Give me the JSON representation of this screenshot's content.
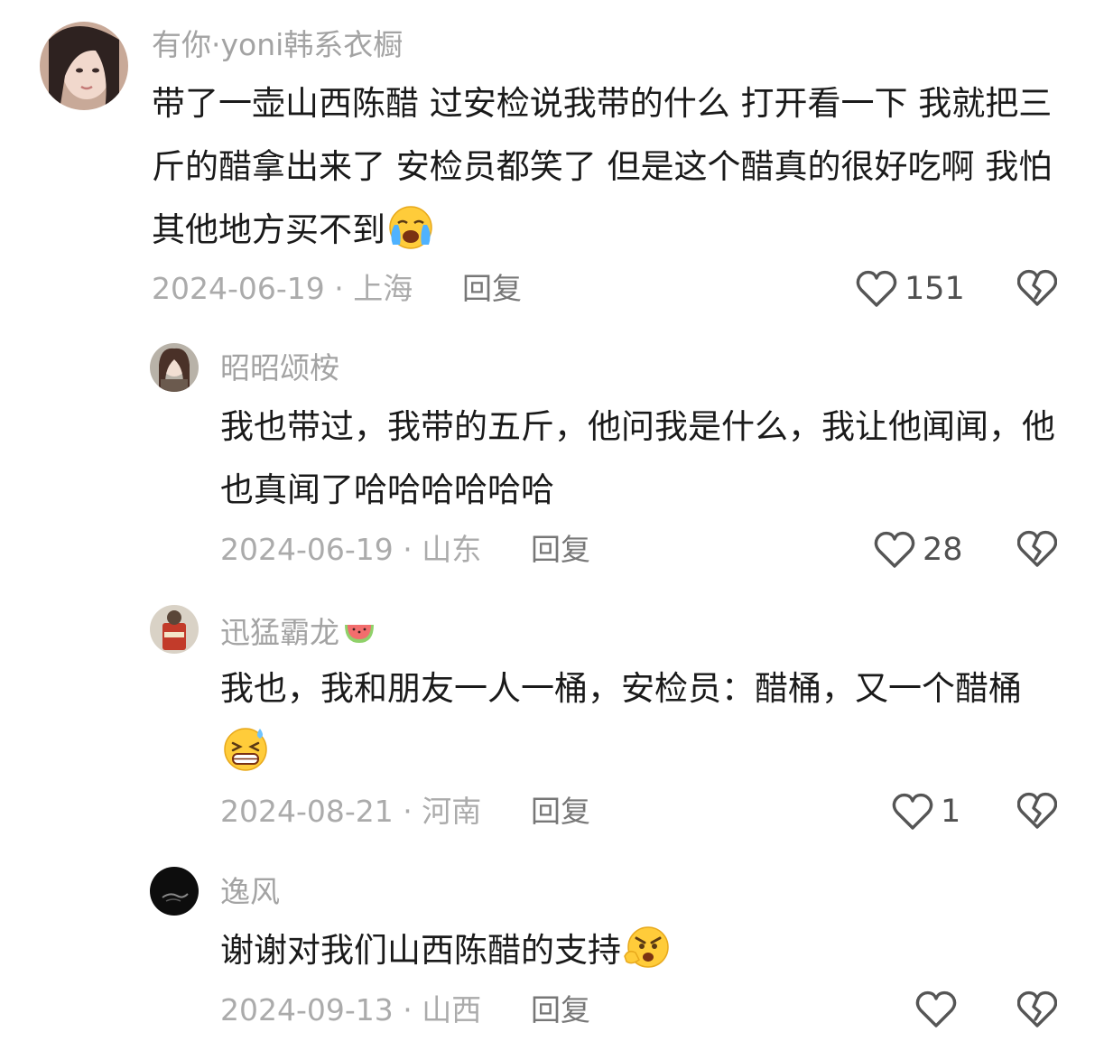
{
  "comments": [
    {
      "username": "有你·yoni韩系衣橱",
      "text": "带了一壶山西陈醋 过安检说我带的什么 打开看一下 我就把三斤的醋拿出来了 安检员都笑了 但是这个醋真的很好吃啊 我怕其他地方买不到",
      "emoji": "crying-face-emoji",
      "date": "2024-06-19",
      "location": "上海",
      "reply_label": "回复",
      "likes": "151"
    },
    {
      "username": "昭昭颂桉",
      "text": "我也带过，我带的五斤，他问我是什么，我让他闻闻，他也真闻了哈哈哈哈哈哈",
      "date": "2024-06-19",
      "location": "山东",
      "reply_label": "回复",
      "likes": "28"
    },
    {
      "username": "迅猛霸龙",
      "username_emoji": "watermelon-emoji",
      "text": "我也，我和朋友一人一桶，安检员：醋桶，又一个醋桶",
      "emoji": "grinning-sweat-emoji",
      "date": "2024-08-21",
      "location": "河南",
      "reply_label": "回复",
      "likes": "1"
    },
    {
      "username": "逸风",
      "text": "谢谢对我们山西陈醋的支持",
      "emoji": "angry-pointing-emoji",
      "date": "2024-09-13",
      "location": "山西",
      "reply_label": "回复",
      "likes": ""
    }
  ],
  "separator": " · ",
  "icons": {
    "like": "heart-outline-icon",
    "dislike": "broken-heart-icon"
  },
  "colors": {
    "username": "#a3a3a3",
    "text": "#1a1a1a",
    "meta": "#ababab",
    "icon": "#555555"
  }
}
